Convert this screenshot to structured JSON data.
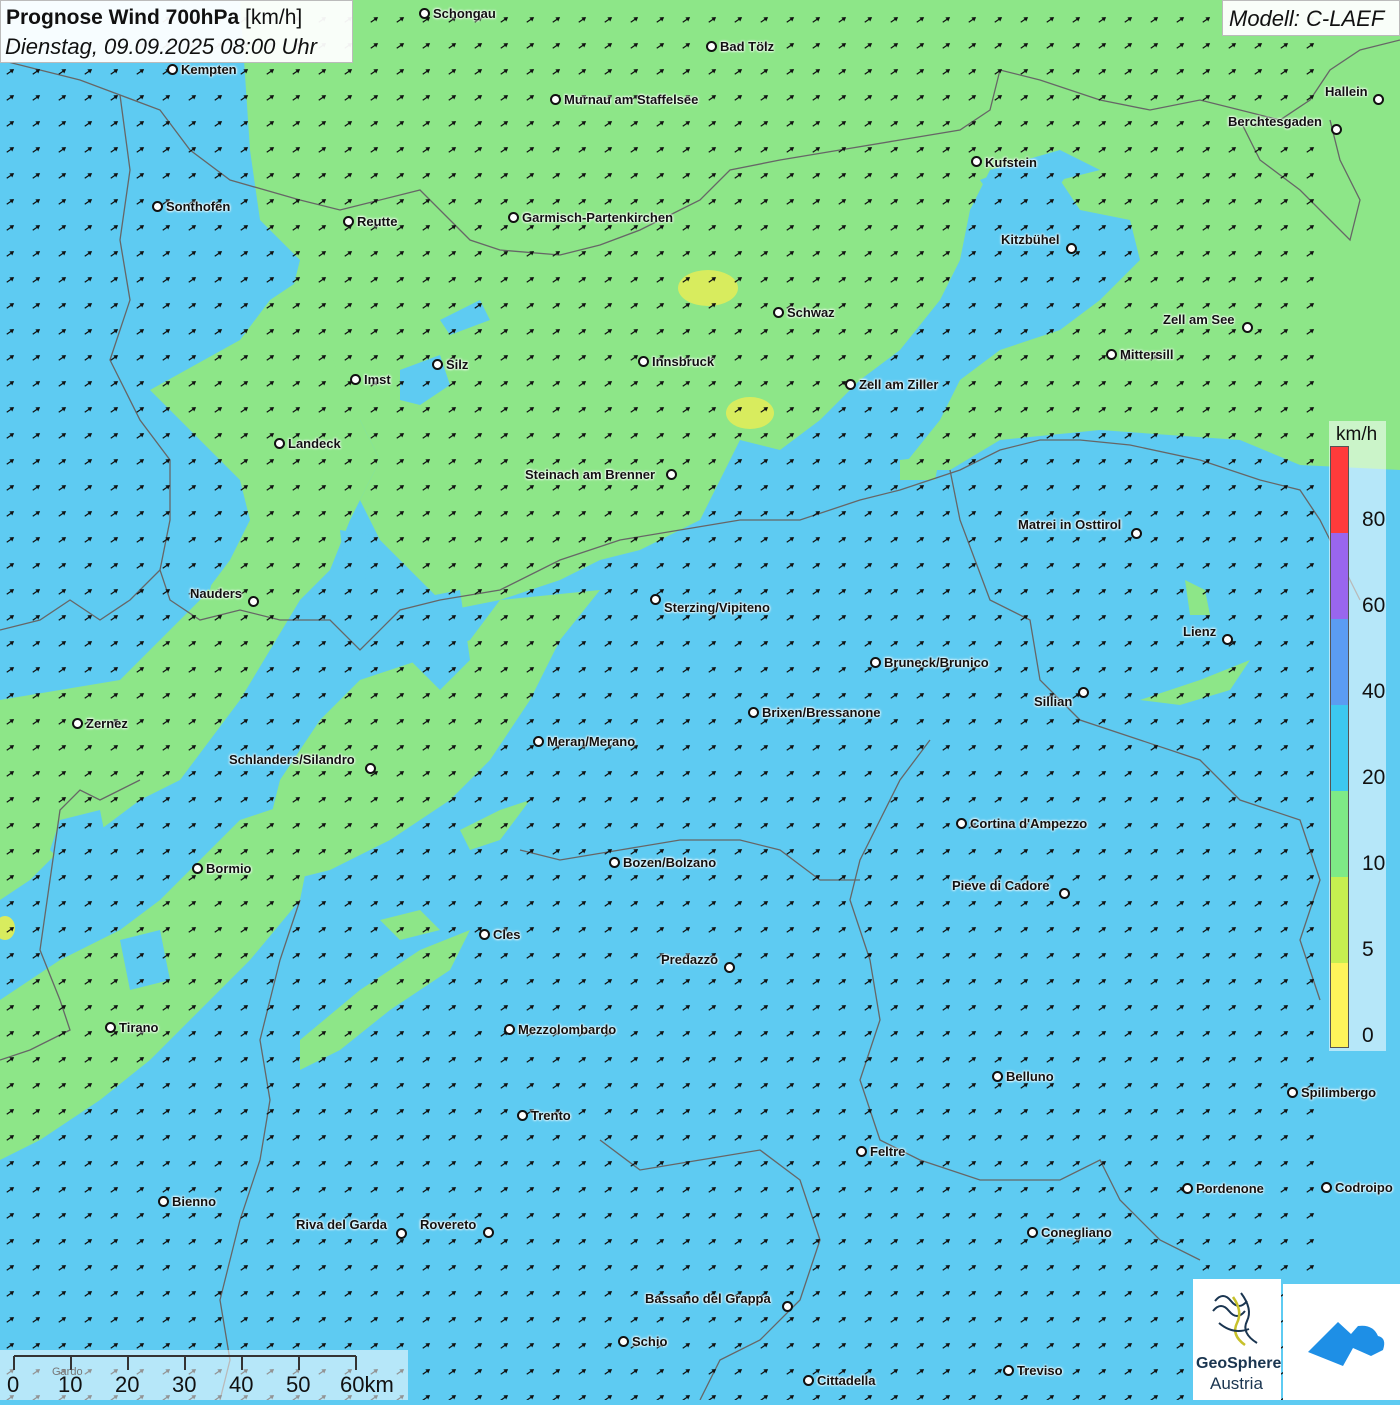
{
  "header": {
    "title": "Prognose Wind 700hPa",
    "unit": "[km/h]",
    "datetime": "Dienstag, 09.09.2025 08:00 Uhr",
    "model": "Modell: C-LAEF"
  },
  "legend": {
    "unit": "km/h",
    "ticks": [
      "80",
      "60",
      "40",
      "20",
      "10",
      "5",
      "0"
    ],
    "colors": [
      "#ff3b3b",
      "#9966ee",
      "#5b9cf2",
      "#3cc8f0",
      "#7eea86",
      "#c6ef50",
      "#fef45a"
    ]
  },
  "scale_bar": {
    "labels": [
      "0",
      "10",
      "20",
      "30",
      "40",
      "50",
      "60km"
    ],
    "watermark": "Gardo"
  },
  "logos": {
    "geosphere_line1": "GeoSphere",
    "geosphere_line2": "Austria"
  },
  "colors": {
    "green_zone": "#8de688",
    "blue_zone": "#5ecbf2",
    "yellow_spot": "#d8ec5e",
    "arrow": "#111111",
    "border_lines": "#666666"
  },
  "cities": [
    {
      "name": "Schongau"
    },
    {
      "name": "Bad Tölz"
    },
    {
      "name": "Kempten"
    },
    {
      "name": "Murnau am Staffelsee"
    },
    {
      "name": "Hallein"
    },
    {
      "name": "Berchtesgaden"
    },
    {
      "name": "Kufstein"
    },
    {
      "name": "Sonthofen"
    },
    {
      "name": "Reutte"
    },
    {
      "name": "Garmisch-Partenkirchen"
    },
    {
      "name": "Kitzbühel"
    },
    {
      "name": "Schwaz"
    },
    {
      "name": "Zell am See"
    },
    {
      "name": "Mittersill"
    },
    {
      "name": "Innsbruck"
    },
    {
      "name": "Silz"
    },
    {
      "name": "Imst"
    },
    {
      "name": "Zell am Ziller"
    },
    {
      "name": "Landeck"
    },
    {
      "name": "Steinach am Brenner"
    },
    {
      "name": "Matrei in Osttirol"
    },
    {
      "name": "Nauders"
    },
    {
      "name": "Sterzing/Vipiteno"
    },
    {
      "name": "Lienz"
    },
    {
      "name": "Bruneck/Brunico"
    },
    {
      "name": "Sillian"
    },
    {
      "name": "Zernez"
    },
    {
      "name": "Brixen/Bressanone"
    },
    {
      "name": "Meran/Merano"
    },
    {
      "name": "Schlanders/Silandro"
    },
    {
      "name": "Cortina d'Ampezzo"
    },
    {
      "name": "Bozen/Bolzano"
    },
    {
      "name": "Bormio"
    },
    {
      "name": "Pieve di Cadore"
    },
    {
      "name": "Cles"
    },
    {
      "name": "Predazzo"
    },
    {
      "name": "Tirano"
    },
    {
      "name": "Mezzolombardo"
    },
    {
      "name": "Belluno"
    },
    {
      "name": "Spilimbergo"
    },
    {
      "name": "Trento"
    },
    {
      "name": "Feltre"
    },
    {
      "name": "Pordenone"
    },
    {
      "name": "Codroipo"
    },
    {
      "name": "Bienno"
    },
    {
      "name": "Riva del Garda"
    },
    {
      "name": "Rovereto"
    },
    {
      "name": "Conegliano"
    },
    {
      "name": "Bassano del Grappa"
    },
    {
      "name": "Schio"
    },
    {
      "name": "Treviso"
    },
    {
      "name": "Cittadella"
    }
  ]
}
